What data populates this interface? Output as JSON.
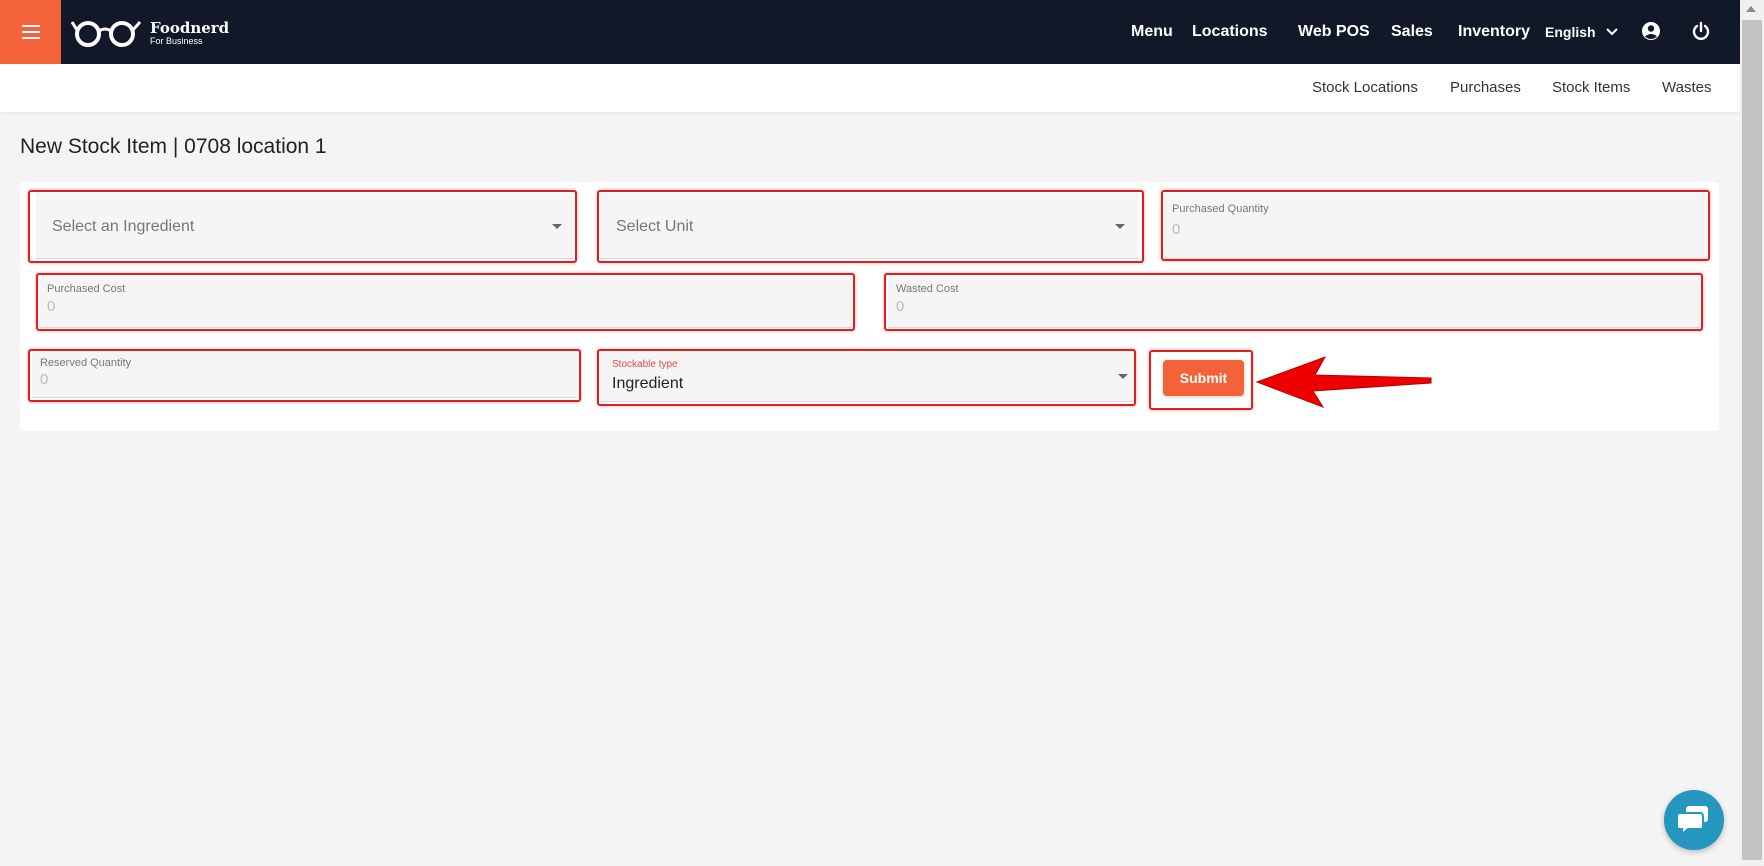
{
  "brand": {
    "name": "Foodnerd",
    "subtitle": "For Business",
    "accent_color": "#f4623a",
    "topbar_color": "#111827"
  },
  "nav": {
    "items": [
      {
        "label": "Menu"
      },
      {
        "label": "Locations"
      },
      {
        "label": "Web POS"
      },
      {
        "label": "Sales"
      },
      {
        "label": "Inventory"
      }
    ],
    "language": "English",
    "icons": [
      "account-circle-icon",
      "power-icon"
    ]
  },
  "subnav": {
    "items": [
      {
        "label": "Stock Locations"
      },
      {
        "label": "Purchases"
      },
      {
        "label": "Stock Items"
      },
      {
        "label": "Wastes"
      }
    ]
  },
  "page": {
    "title": "New Stock Item | 0708 location 1"
  },
  "form": {
    "ingredient": {
      "placeholder": "Select an Ingredient"
    },
    "unit": {
      "placeholder": "Select Unit"
    },
    "purchased_quantity": {
      "label": "Purchased Quantity",
      "placeholder": "0"
    },
    "purchased_cost": {
      "label": "Purchased Cost",
      "placeholder": "0"
    },
    "wasted_cost": {
      "label": "Wasted Cost",
      "placeholder": "0"
    },
    "reserved_quantity": {
      "label": "Reserved Quantity",
      "placeholder": "0"
    },
    "stockable_type": {
      "label": "Stockable type",
      "value": "Ingredient"
    },
    "submit_label": "Submit"
  },
  "annotation_color": "#e11d1d"
}
